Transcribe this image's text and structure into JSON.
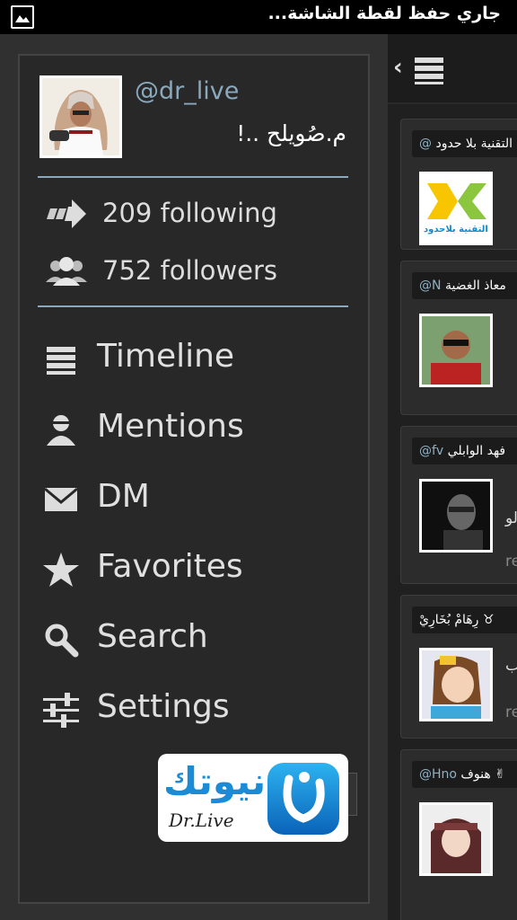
{
  "status_bar": {
    "text": "جاري حفظ لقطة الشاشة...",
    "icon": "screenshot-icon"
  },
  "profile": {
    "handle": "@dr_live",
    "display_name": "م.صُويلح ..!",
    "following": "209 following",
    "followers": "752 followers"
  },
  "nav": [
    {
      "label": "Timeline",
      "icon": "timeline-icon"
    },
    {
      "label": "Mentions",
      "icon": "mentions-icon"
    },
    {
      "label": "DM",
      "icon": "mail-icon"
    },
    {
      "label": "Favorites",
      "icon": "star-icon"
    },
    {
      "label": "Search",
      "icon": "search-icon"
    },
    {
      "label": "Settings",
      "icon": "settings-sliders-icon"
    }
  ],
  "watermark": {
    "arabic": "نيوتك",
    "latin": "Dr.Live"
  },
  "timeline": {
    "cards": [
      {
        "name": "التقنية بلا حدود",
        "handle": "@",
        "side": "",
        "side2": ""
      },
      {
        "name": "معاذ الغضية",
        "handle": "@N",
        "side": "",
        "side2": ""
      },
      {
        "name": "فهد الوابلي",
        "handle": "@fv",
        "side": "لو",
        "side2": "re"
      },
      {
        "name": "رِهَامْ بُخَارِيْ ♉",
        "handle": "",
        "side": "ب",
        "side2": "re"
      },
      {
        "name": "هنوف ✌",
        "handle": "@Hno",
        "side": "",
        "side2": ""
      }
    ],
    "thumb_text": "التقنية بلاحدود"
  },
  "colors": {
    "accent": "#8aa9bd",
    "drawer_bg": "#282828",
    "text": "#e0e0e0"
  }
}
